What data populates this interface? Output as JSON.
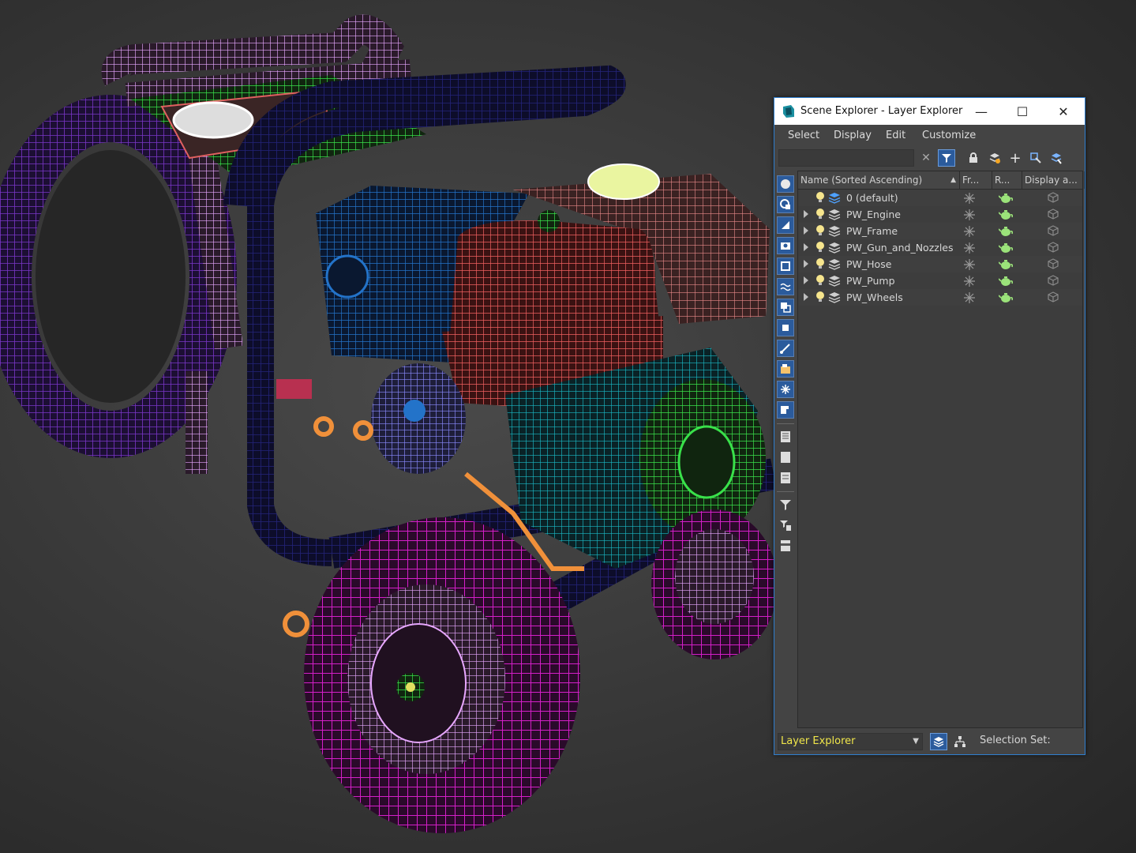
{
  "window": {
    "title": "Scene Explorer - Layer Explorer",
    "controls": [
      "—",
      "☐",
      "✕"
    ]
  },
  "menu": [
    "Select",
    "Display",
    "Edit",
    "Customize"
  ],
  "search": {
    "value": ""
  },
  "columns": [
    "Name (Sorted Ascending)",
    "Fr...",
    "R...",
    "Display a..."
  ],
  "layers": [
    {
      "name": "0 (default)",
      "expandable": false
    },
    {
      "name": "PW_Engine",
      "expandable": true
    },
    {
      "name": "PW_Frame",
      "expandable": true
    },
    {
      "name": "PW_Gun_and_Nozzles",
      "expandable": true
    },
    {
      "name": "PW_Hose",
      "expandable": true
    },
    {
      "name": "PW_Pump",
      "expandable": true
    },
    {
      "name": "PW_Wheels",
      "expandable": true
    }
  ],
  "statusbar": {
    "explorer": "Layer Explorer",
    "selection_set_label": "Selection Set:"
  },
  "colors": {
    "accent": "#2f7fd0",
    "explorer_text": "#f0e64a",
    "wire_frame": "#e7a7ff",
    "wire_hose": "#6a2fb5",
    "wire_wheels": "#d41fc8",
    "wire_engine_cover": "#f05a5a",
    "wire_engine_block": "#1b6fb5",
    "wire_pump": "#1ab7c4",
    "wire_green": "#39e04a"
  }
}
